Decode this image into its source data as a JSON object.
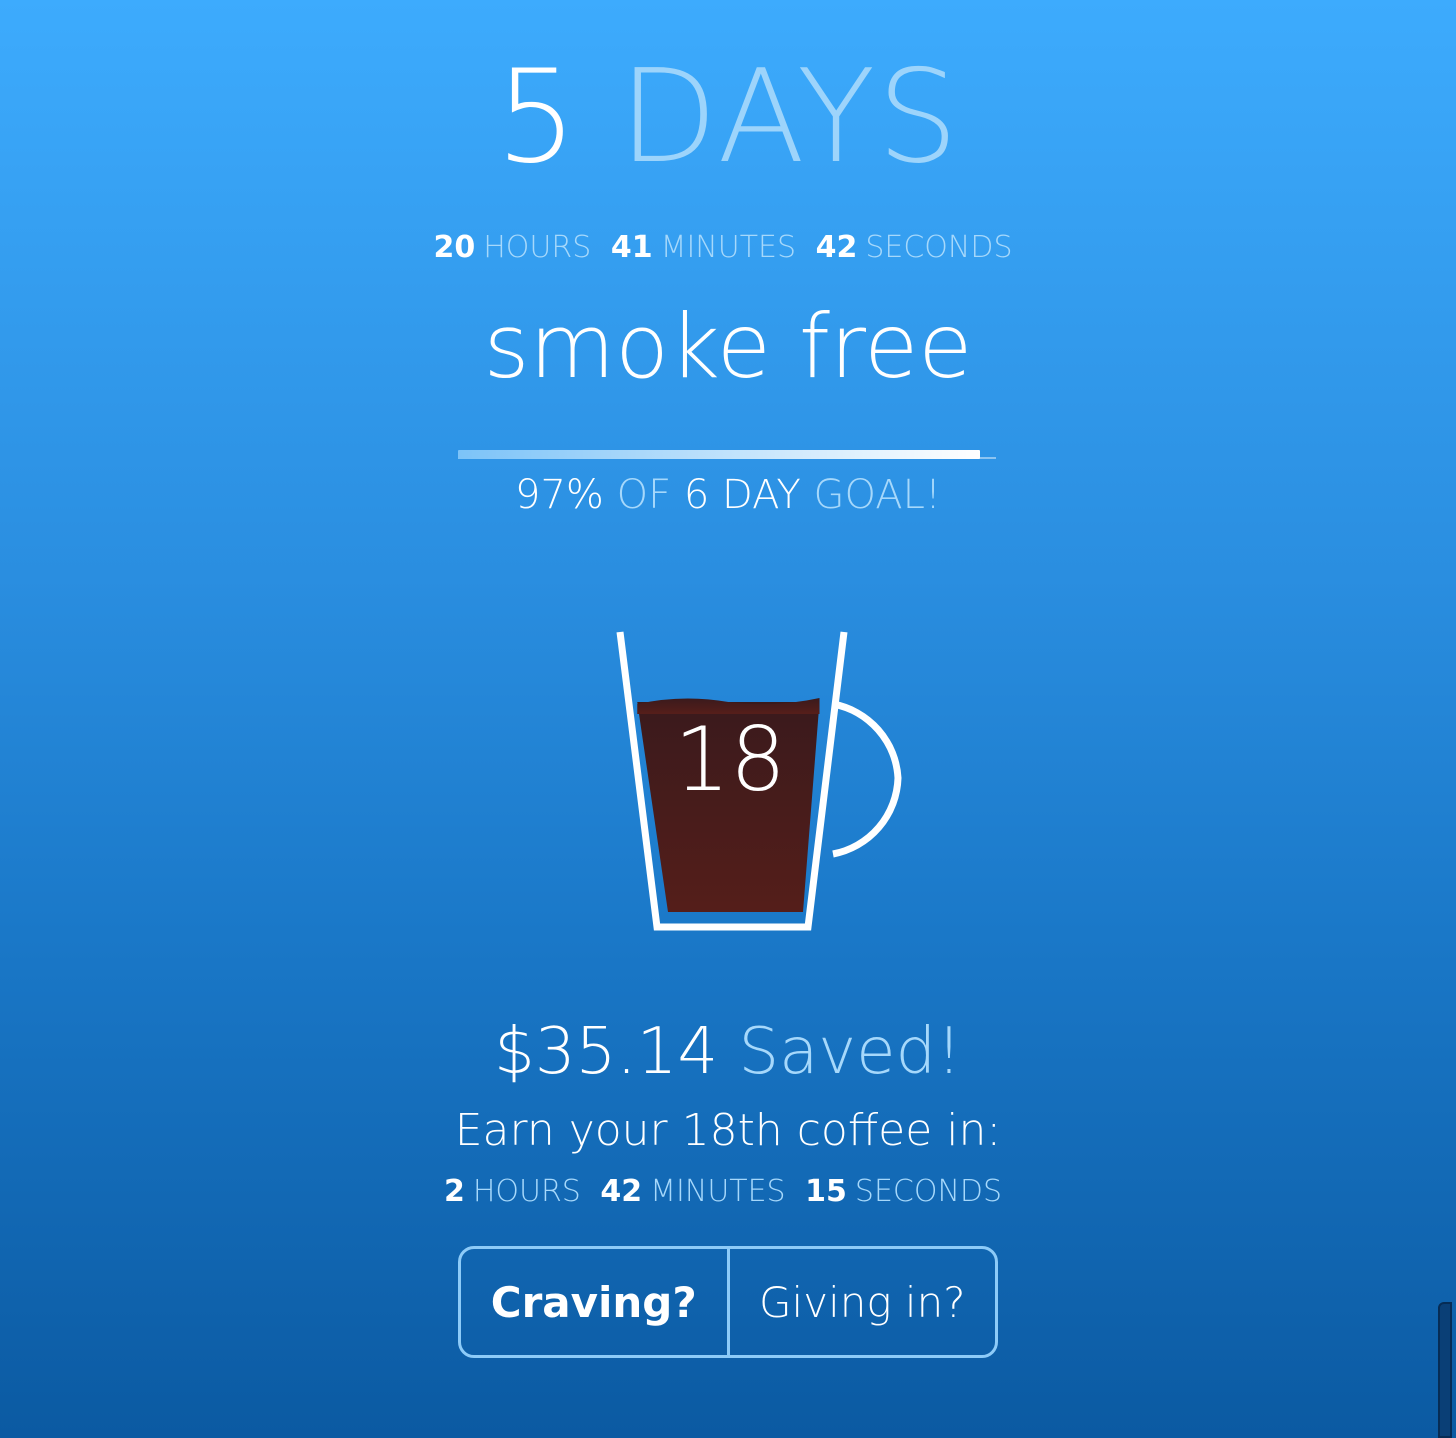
{
  "counter": {
    "days_value": "5",
    "days_unit": "DAYS",
    "hours_value": "20",
    "hours_unit": "HOURS",
    "minutes_value": "41",
    "minutes_unit": "MINUTES",
    "seconds_value": "42",
    "seconds_unit": "SECONDS",
    "status": "smoke free"
  },
  "goal": {
    "progress_percent": 97,
    "percent_text": "97%",
    "of_text": "OF",
    "goal_text": "6 DAY",
    "suffix_text": "GOAL!"
  },
  "coffee": {
    "count": "18",
    "fill_level": 0.75,
    "icon": "coffee-mug-icon",
    "coffee_color": "#4a1e1a"
  },
  "savings": {
    "amount": "$35.14",
    "label": "Saved!",
    "earn_text": "Earn your 18th coffee in:",
    "hours_value": "2",
    "hours_unit": "HOURS",
    "minutes_value": "42",
    "minutes_unit": "MINUTES",
    "seconds_value": "15",
    "seconds_unit": "SECONDS"
  },
  "actions": {
    "craving_label": "Craving?",
    "giving_in_label": "Giving in?"
  },
  "colors": {
    "background_top": "#3dabfd",
    "background_bottom": "#0b5aa2",
    "accent_light": "#a6d8fb",
    "button_border": "#8dcbf8"
  }
}
